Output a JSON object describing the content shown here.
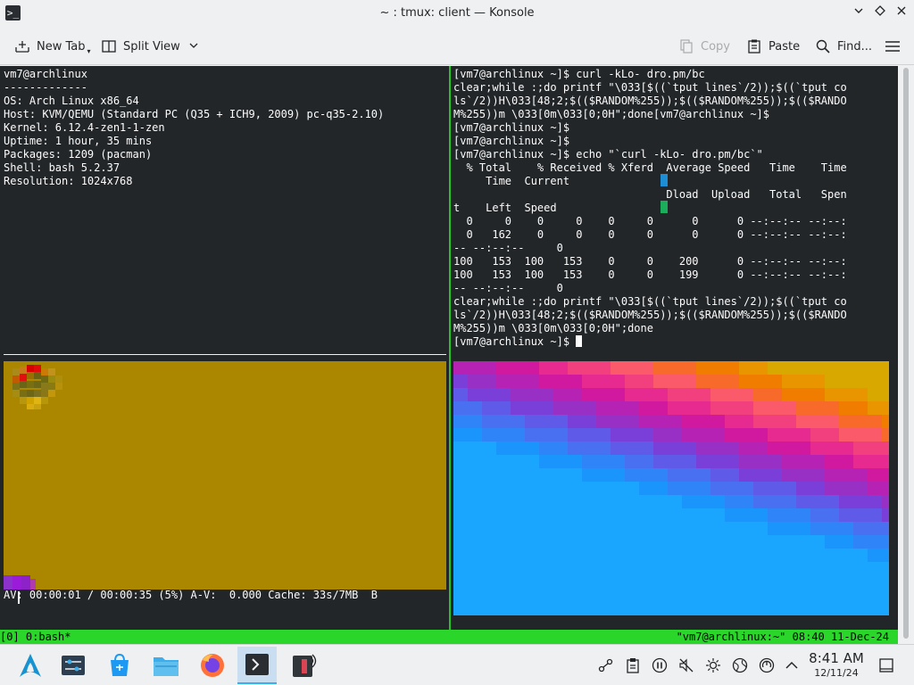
{
  "window": {
    "title": "~ : tmux: client — Konsole",
    "app_icon": "terminal-icon",
    "controls": [
      "chevron-down-icon",
      "diamond-icon",
      "close-icon"
    ]
  },
  "toolbar": {
    "new_tab": "New Tab",
    "split_view": "Split View",
    "copy": "Copy",
    "paste": "Paste",
    "find": "Find...",
    "menu_icon": "hamburger-menu-icon"
  },
  "panes": {
    "top_left": {
      "lines": [
        "vm7@archlinux",
        "-------------",
        "OS: Arch Linux x86_64",
        "Host: KVM/QEMU (Standard PC (Q35 + ICH9, 2009) pc-q35-2.10)",
        "Kernel: 6.12.4-zen1-1-zen",
        "Uptime: 1 hour, 35 mins",
        "Packages: 1209 (pacman)",
        "Shell: bash 5.2.37",
        "Resolution: 1024x768"
      ]
    },
    "top_right": {
      "lines": [
        "[vm7@archlinux ~]$ curl -kLo- dro.pm/bc",
        "clear;while :;do printf \"\\033[$((`tput lines`/2));$((`tput co",
        "ls`/2))H\\033[48;2;$(($RANDOM%255));$(($RANDOM%255));$(($RANDO",
        "M%255))m \\033[0m\\033[0;0H\";done[vm7@archlinux ~]$",
        "[vm7@archlinux ~]$",
        "[vm7@archlinux ~]$",
        "[vm7@archlinux ~]$ echo \"`curl -kLo- dro.pm/bc`\"",
        "  % Total    % Received % Xferd  Average Speed   Time    Time",
        "     Time  Current",
        "                                 Dload  Upload   Total   Spen",
        "t    Left  Speed",
        "  0     0    0     0    0     0      0      0 --:--:-- --:--:",
        "  0   162    0     0    0     0      0      0 --:--:-- --:--:",
        "-- --:--:--     0",
        "100   153  100   153    0     0    200      0 --:--:-- --:--:",
        "100   153  100   153    0     0    199      0 --:--:-- --:--:",
        "-- --:--:--     0",
        "clear;while :;do printf \"\\033[$((`tput lines`/2));$((`tput co",
        "ls`/2))H\\033[48;2;$(($RANDOM%255));$(($RANDOM%255));$(($RANDO",
        "M%255))m \\033[0m\\033[0;0H\";done",
        "[vm7@archlinux ~]$ "
      ]
    },
    "bottom_left": {
      "status": "AV: 00:00:01 / 00:00:35 (5%) A-V:  0.000 Cache: 33s/7MB  B"
    }
  },
  "tmux": {
    "left": "[0] 0:bash*",
    "right": "\"vm7@archlinux:~\" 08:40 11-Dec-24"
  },
  "taskbar": {
    "launcher_icon": "arch-linux-logo-icon",
    "tasks": [
      "system-settings-icon",
      "discover-store-icon",
      "file-manager-icon",
      "firefox-icon",
      "konsole-icon",
      "media-player-icon"
    ],
    "tray_icons": [
      "network-icon",
      "clipboard-icon",
      "pause-icon",
      "volume-muted-icon",
      "brightness-icon",
      "globe-icon",
      "update-icon",
      "chevron-up-icon"
    ],
    "time": "8:41 AM",
    "date": "12/11/24",
    "show_desktop_icon": "show-desktop-icon"
  },
  "colors": {
    "terminal_bg": "#232629",
    "tmux_green": "#2bd62b",
    "video_bg": "#ab8700",
    "accent": "#3daee9"
  }
}
